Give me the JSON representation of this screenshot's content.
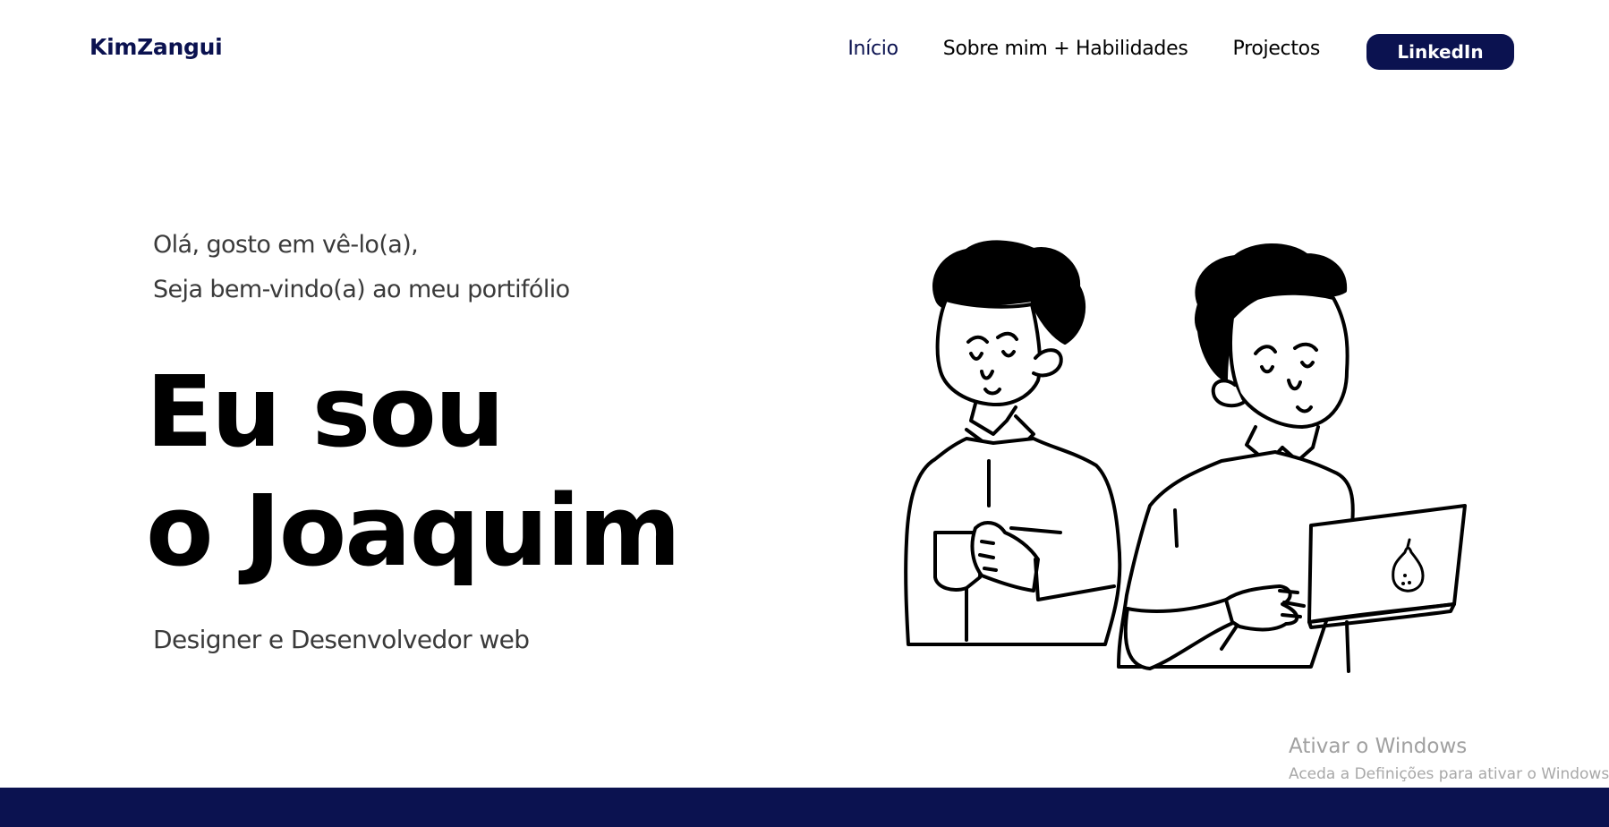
{
  "header": {
    "logo": "KimZangui",
    "nav": {
      "inicio": "Início",
      "sobre": "Sobre mim + Habilidades",
      "projectos": "Projectos"
    },
    "linkedin_label": "LinkedIn"
  },
  "hero": {
    "greeting_line1": "Olá, gosto em vê-lo(a),",
    "greeting_line2": "Seja bem-vindo(a) ao meu portifólio",
    "headline_line1": "Eu sou",
    "headline_line2": "o Joaquim",
    "role": "Designer e Desenvolvedor web"
  },
  "windows_watermark": {
    "title": "Ativar o Windows",
    "subtitle": "Aceda a Definições para ativar o Windows."
  },
  "colors": {
    "brand": "#0b1250",
    "text_dark": "#000000",
    "text_muted": "#3a3a3a"
  },
  "icons": {
    "illustration": "two-developers-with-coffee-and-laptop-illustration",
    "laptop_logo": "pear-icon"
  }
}
